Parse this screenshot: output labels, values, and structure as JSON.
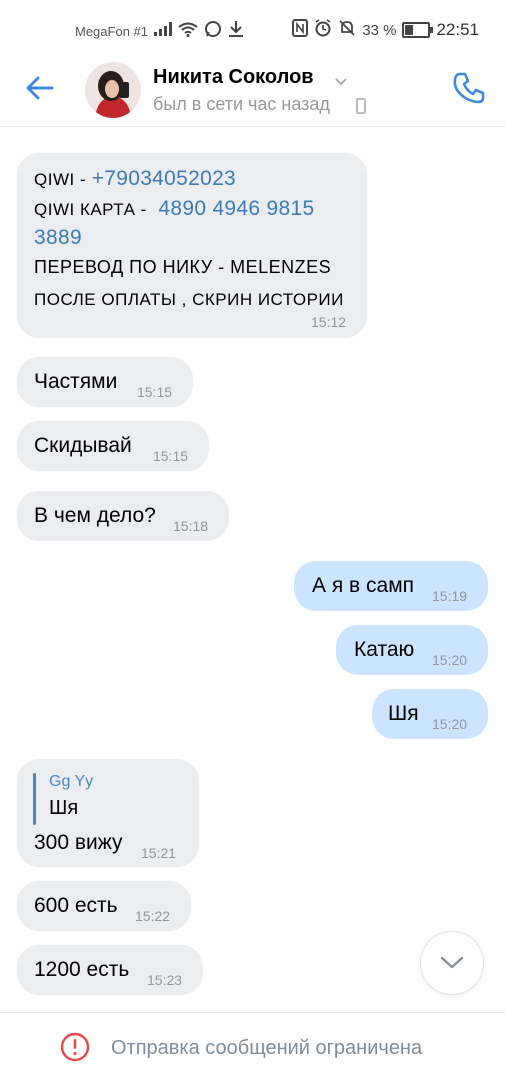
{
  "status_bar": {
    "carrier": "MegaFon #1",
    "battery_percent": "33 %",
    "time": "22:51"
  },
  "header": {
    "contact_name": "Никита Соколов",
    "status": "был в сети час назад"
  },
  "messages": {
    "m1": {
      "qiwi_label": "QIWI -",
      "qiwi_phone": "+79034052023",
      "card_label": "QIWI КАРТА -",
      "card_number_1": "4890 4946 9815",
      "card_number_2": "3889",
      "line3": "ПЕРЕВОД ПО НИКУ - MELENZES",
      "line4": "ПОСЛЕ ОПЛАТЫ , СКРИН ИСТОРИИ",
      "time": "15:12"
    },
    "m2": {
      "text": "Частями",
      "time": "15:15"
    },
    "m3": {
      "text": "Скидывай",
      "time": "15:15"
    },
    "m4": {
      "text": "В чем дело?",
      "time": "15:18"
    },
    "m5": {
      "text": "А я в самп",
      "time": "15:19"
    },
    "m6": {
      "text": "Катаю",
      "time": "15:20"
    },
    "m7": {
      "text": "Шя",
      "time": "15:20"
    },
    "m8": {
      "reply_author": "Gg Yy",
      "reply_text": "Шя",
      "text": "300 вижу",
      "time": "15:21"
    },
    "m9": {
      "text": "600 есть",
      "time": "15:22"
    },
    "m10": {
      "text": "1200 есть",
      "time": "15:23"
    }
  },
  "bottom_bar": {
    "text": "Отправка сообщений ограничена"
  },
  "colors": {
    "accent": "#3f8ae0",
    "incoming_bubble": "#ebedf0",
    "outgoing_bubble": "#cce4ff",
    "link": "#3d7ab8",
    "warning": "#e64646"
  }
}
